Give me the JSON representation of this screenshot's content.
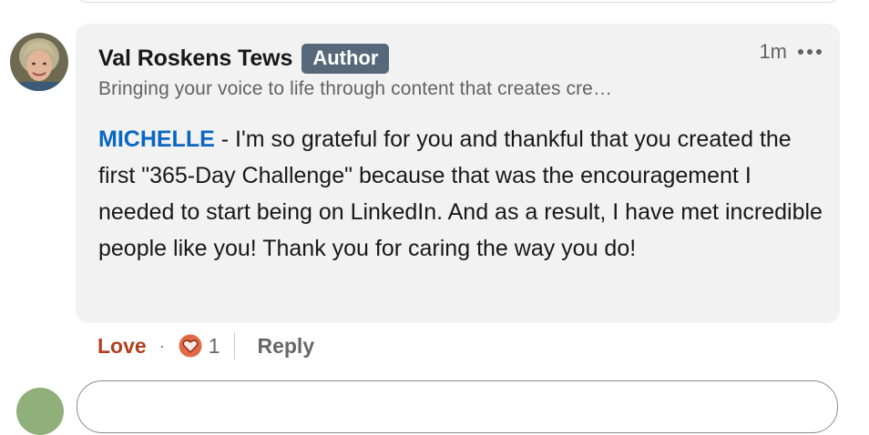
{
  "comment": {
    "author": {
      "name": "Val Roskens Tews",
      "badge": "Author",
      "headline": "Bringing your voice to life through content that creates cre…"
    },
    "timestamp": "1m",
    "more_icon": "ellipsis-horizontal-icon",
    "text": {
      "mention": "MICHELLE",
      "body": " - I'm so grateful for you and thankful that you created the first \"365-Day Challenge\" because that was the encouragement I needed to start being on LinkedIn. And as a result, I have met incredible people like you! Thank you for caring the way you do!"
    }
  },
  "actions": {
    "love_label": "Love",
    "separator": "·",
    "reaction_icon": "love-reaction-icon",
    "reaction_count": "1",
    "reply_label": "Reply"
  },
  "colors": {
    "mention": "#0a66c2",
    "love": "#b24020",
    "badge_bg": "#56687a",
    "bubble_bg": "#f2f2f2",
    "reaction_bg": "#e06a45"
  }
}
